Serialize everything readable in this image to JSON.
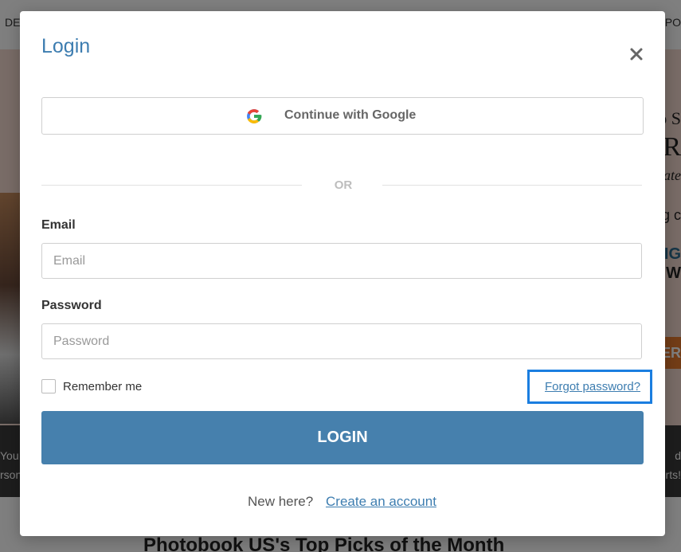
{
  "background": {
    "nav_left": "DE",
    "nav_right": "RPO",
    "hero_lines": [
      "o S",
      "R",
      "ate",
      "g c",
      "BIG",
      "W"
    ],
    "hero_button": "ER",
    "band_left": [
      "You",
      "rson"
    ],
    "band_right": [
      "d",
      "rts!"
    ],
    "heading": "Photobook US's Top Picks of the Month"
  },
  "modal": {
    "title": "Login",
    "close_icon": "close-icon",
    "google_button_label": "Continue with Google",
    "divider_text": "OR",
    "email": {
      "label": "Email",
      "placeholder": "Email",
      "value": ""
    },
    "password": {
      "label": "Password",
      "placeholder": "Password",
      "value": ""
    },
    "remember_me_label": "Remember me",
    "remember_me_checked": false,
    "forgot_password_label": "Forgot password?",
    "login_button_label": "LOGIN",
    "signup_prompt": "New here?",
    "signup_link_label": "Create an account"
  },
  "colors": {
    "accent": "#4680ad",
    "title": "#3d7db0",
    "highlight_box": "#1a7ee0"
  }
}
